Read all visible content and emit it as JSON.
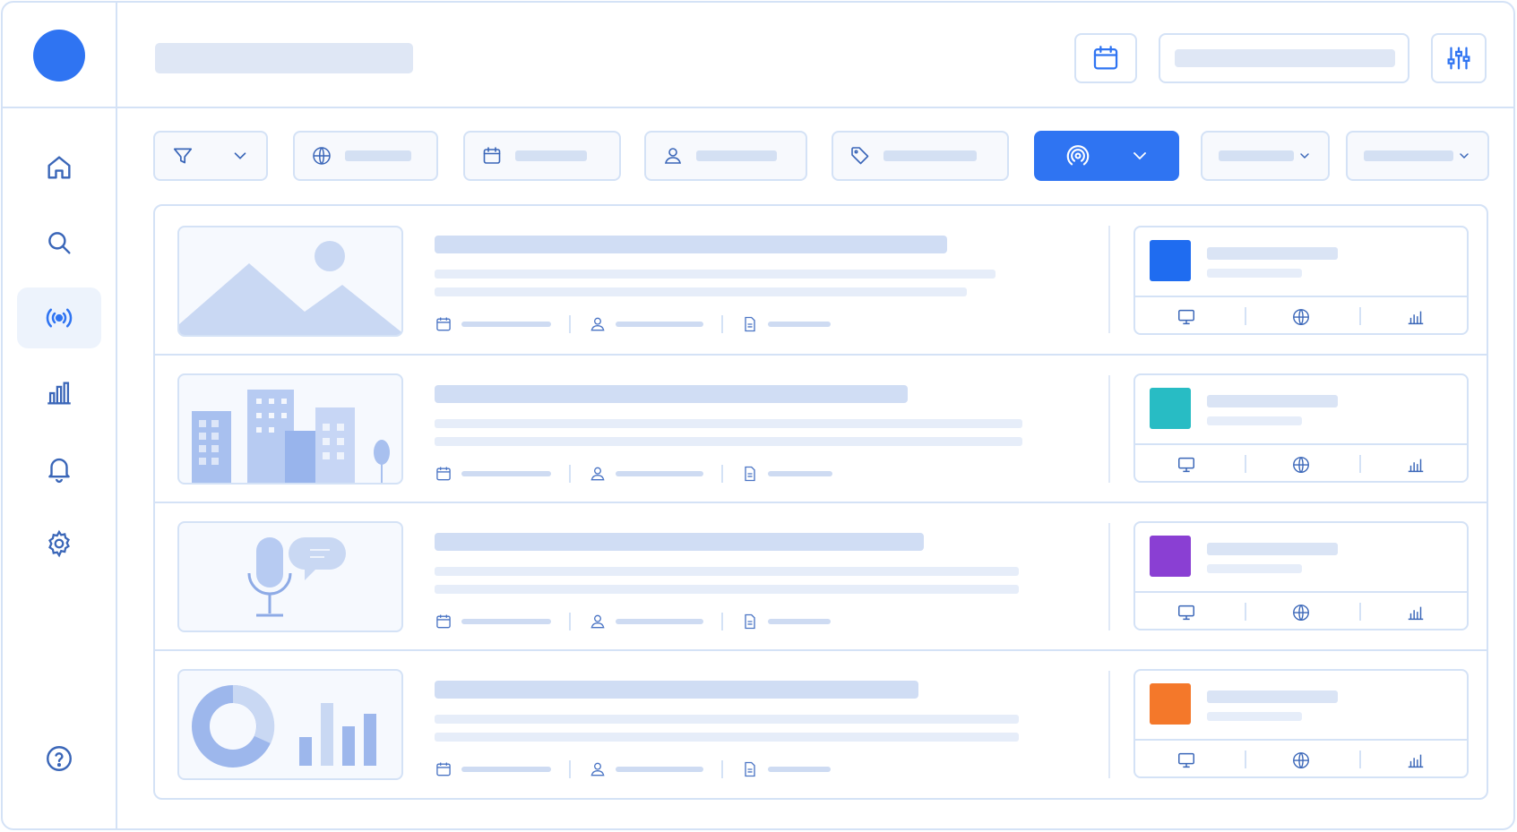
{
  "app": {
    "accent_color": "#2f74f2",
    "border_color": "#d4e2f6"
  },
  "sidebar": {
    "items": [
      {
        "name": "home",
        "icon": "home-icon",
        "active": false
      },
      {
        "name": "search",
        "icon": "search-icon",
        "active": false
      },
      {
        "name": "broadcast",
        "icon": "broadcast-icon",
        "active": true
      },
      {
        "name": "analytics",
        "icon": "bar-chart-icon",
        "active": false
      },
      {
        "name": "notifications",
        "icon": "bell-icon",
        "active": false
      },
      {
        "name": "settings",
        "icon": "gear-icon",
        "active": false
      }
    ],
    "help_icon": "help-icon"
  },
  "topbar": {
    "calendar_icon": "calendar-icon",
    "sliders_icon": "sliders-icon"
  },
  "filters": [
    {
      "name": "filter",
      "icon": "filter-icon"
    },
    {
      "name": "region",
      "icon": "globe-icon"
    },
    {
      "name": "date",
      "icon": "calendar-icon"
    },
    {
      "name": "author",
      "icon": "user-icon"
    },
    {
      "name": "tag",
      "icon": "tag-icon"
    },
    {
      "name": "channel",
      "icon": "broadcast-icon",
      "active": true
    },
    {
      "name": "sort-a",
      "icon": "chevron-down-icon"
    },
    {
      "name": "sort-b",
      "icon": "chevron-down-icon"
    }
  ],
  "rows": [
    {
      "thumbnail": "landscape-image",
      "swatch_color": "#1f6cf0"
    },
    {
      "thumbnail": "city-buildings-image",
      "swatch_color": "#28bcc4"
    },
    {
      "thumbnail": "microphone-chat-image",
      "swatch_color": "#8a3fd3"
    },
    {
      "thumbnail": "donut-bar-chart-image",
      "swatch_color": "#f4782a"
    }
  ],
  "row_meta_icons": [
    "calendar-icon",
    "user-icon",
    "document-icon"
  ],
  "card_footer_icons": [
    "monitor-icon",
    "globe-icon",
    "bar-chart-icon"
  ]
}
